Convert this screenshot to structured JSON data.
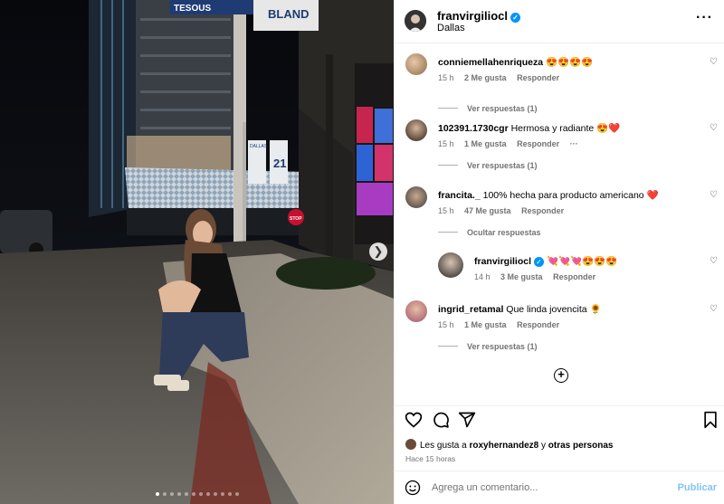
{
  "post": {
    "username": "franvirgiliocl",
    "location": "Dallas",
    "carousel_slides": 12,
    "active_slide": 1
  },
  "photo_signs": {
    "street_left": "TESOUS",
    "street_right": "BLAND",
    "banner_team": "DALLAS",
    "banner_number": "21",
    "stop": "STOP"
  },
  "comments": [
    {
      "user": "conniemellahenriqueza",
      "text": "😍😍😍😍",
      "time": "15 h",
      "likes": "2 Me gusta",
      "reply": "Responder",
      "replies": "Ver respuestas (1)"
    },
    {
      "user": "102391.1730cgr",
      "text": "Hermosa y radiante 😍❤️",
      "time": "15 h",
      "likes": "1 Me gusta",
      "reply": "Responder",
      "replies": "Ver respuestas (1)"
    },
    {
      "user": "francita._",
      "text": "100% hecha para producto americano ❤️",
      "time": "15 h",
      "likes": "47 Me gusta",
      "reply": "Responder",
      "replies": "Ocultar respuestas"
    },
    {
      "user": "franvirgiliocl",
      "text": "💘💘💘😍😍😍",
      "time": "14 h",
      "likes": "3 Me gusta",
      "reply": "Responder"
    },
    {
      "user": "ingrid_retamal",
      "text": "Que linda jovencita 🌻",
      "time": "15 h",
      "likes": "1 Me gusta",
      "reply": "Responder",
      "replies": "Ver respuestas (1)"
    }
  ],
  "likes_summary": {
    "prefix": "Les gusta a",
    "user": "roxyhernandez8",
    "middle": "y",
    "others": "otras personas"
  },
  "posted_ago": "Hace 15 horas",
  "composer": {
    "placeholder": "Agrega un comentario...",
    "publish": "Publicar"
  },
  "colors": {
    "accent": "#0095f6",
    "publish_disabled": "#80c4f6",
    "meta": "#737373"
  },
  "icons": [
    "heart-icon",
    "comment-icon",
    "share-icon",
    "bookmark-icon",
    "add-circle-icon",
    "emoji-icon",
    "more-icon",
    "verified-icon",
    "chevron-right-icon"
  ]
}
